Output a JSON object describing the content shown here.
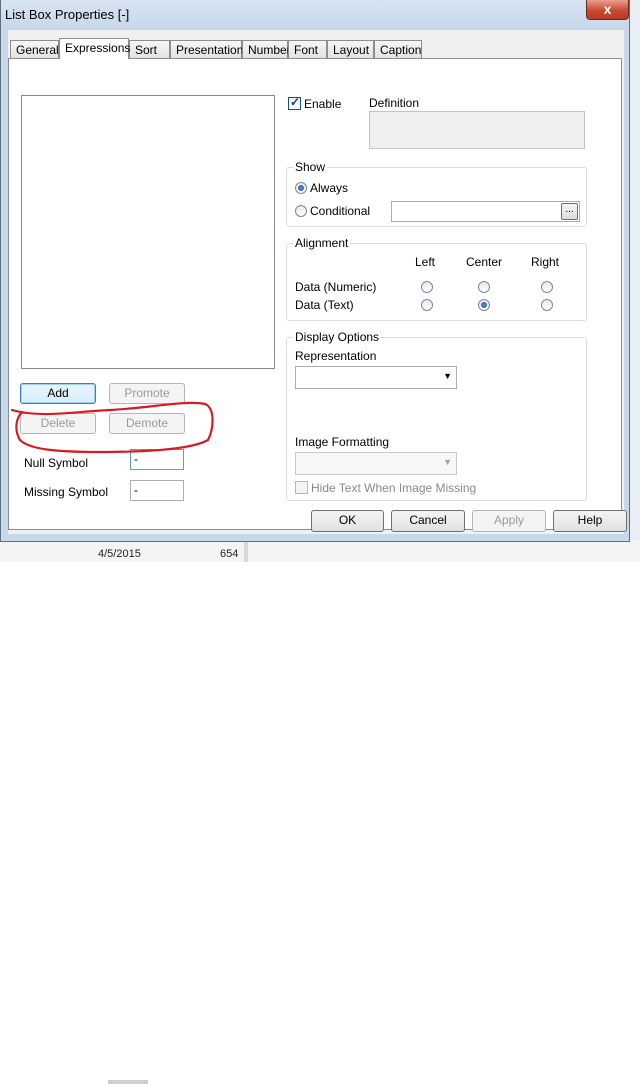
{
  "window": {
    "title": "List Box Properties [-]",
    "close_label": "x"
  },
  "tabs": [
    {
      "label": "General"
    },
    {
      "label": "Expressions",
      "active": true
    },
    {
      "label": "Sort"
    },
    {
      "label": "Presentation"
    },
    {
      "label": "Number"
    },
    {
      "label": "Font"
    },
    {
      "label": "Layout"
    },
    {
      "label": "Caption"
    }
  ],
  "left": {
    "add_label": "Add",
    "promote_label": "Promote",
    "delete_label": "Delete",
    "demote_label": "Demote",
    "null_symbol_label": "Null Symbol",
    "null_symbol_value": "-",
    "missing_symbol_label": "Missing Symbol",
    "missing_symbol_value": "-"
  },
  "right": {
    "enable_label": "Enable",
    "enable_checked": true,
    "definition_label": "Definition",
    "show": {
      "title": "Show",
      "always_label": "Always",
      "conditional_label": "Conditional",
      "selected": "always",
      "ellipsis_label": "..."
    },
    "alignment": {
      "title": "Alignment",
      "columns": [
        "Left",
        "Center",
        "Right"
      ],
      "rows": [
        {
          "label": "Data (Numeric)",
          "selected": ""
        },
        {
          "label": "Data (Text)",
          "selected": "Center"
        }
      ]
    },
    "display_options": {
      "title": "Display Options",
      "representation_label": "Representation",
      "image_formatting_label": "Image Formatting",
      "hide_text_label": "Hide Text When Image Missing"
    }
  },
  "footer": {
    "ok_label": "OK",
    "cancel_label": "Cancel",
    "apply_label": "Apply",
    "help_label": "Help"
  },
  "background": {
    "date": "4/5/2015",
    "value": "654"
  },
  "colors": {
    "annotation": "#d81b22",
    "selected_radio": "#1f4e9a"
  }
}
